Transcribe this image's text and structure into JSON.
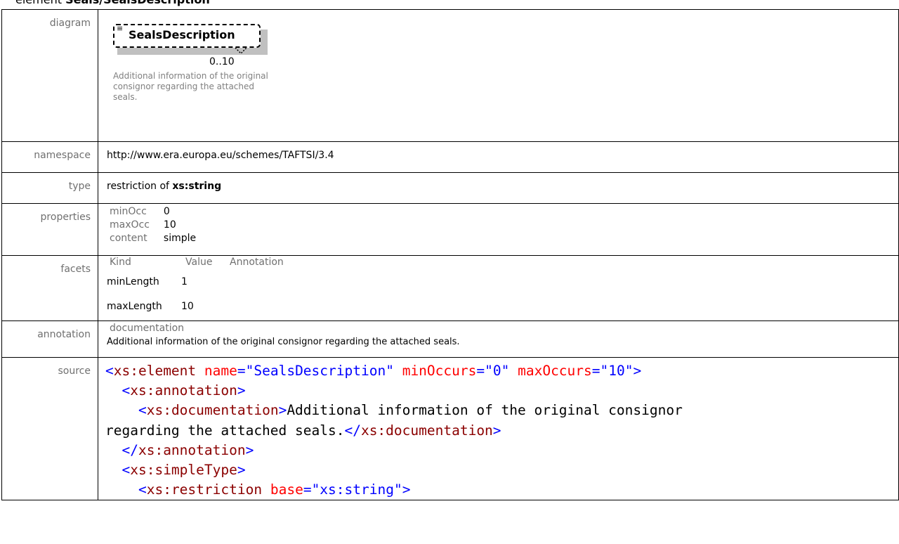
{
  "heading": {
    "prefix": "element ",
    "name": "Seals/SealsDescription"
  },
  "labels": {
    "diagram": "diagram",
    "namespace": "namespace",
    "type": "type",
    "properties": "properties",
    "facets": "facets",
    "annotation": "annotation",
    "source": "source"
  },
  "diagram": {
    "element_name": "SealsDescription",
    "multiplicity": "0..10",
    "doc_glyph": "≡",
    "description": "Additional information of the original consignor regarding the attached seals."
  },
  "namespace": "http://www.era.europa.eu/schemes/TAFTSI/3.4",
  "type": {
    "prefix": "restriction of ",
    "base": "xs:string"
  },
  "properties": [
    {
      "key": "minOcc",
      "value": "0"
    },
    {
      "key": "maxOcc",
      "value": "10"
    },
    {
      "key": "content",
      "value": "simple"
    }
  ],
  "facets": {
    "headers": {
      "kind": "Kind",
      "value": "Value",
      "annotation": "Annotation"
    },
    "rows": [
      {
        "kind": "minLength",
        "value": "1"
      },
      {
        "kind": "maxLength",
        "value": "10"
      }
    ]
  },
  "annotation": {
    "title": "documentation",
    "text": "Additional information of the original consignor regarding the attached seals."
  },
  "source": {
    "l1": {
      "open": "<",
      "tag": "xs:element",
      "a1": "name",
      "v1": "\"SealsDescription\"",
      "a2": "minOccurs",
      "v2": "\"0\"",
      "a3": "maxOccurs",
      "v3": "\"10\"",
      "close": ">"
    },
    "l2": {
      "tag": "xs:annotation"
    },
    "l3": {
      "tag": "xs:documentation",
      "text": "Additional information of the original consignor"
    },
    "l4": {
      "text": "regarding the attached seals.",
      "endtag": "xs:documentation"
    },
    "l5": {
      "endtag": "xs:annotation"
    },
    "l6": {
      "tag": "xs:simpleType"
    },
    "l7": {
      "tag": "xs:restriction",
      "attr": "base",
      "val": "\"xs:string\""
    }
  }
}
